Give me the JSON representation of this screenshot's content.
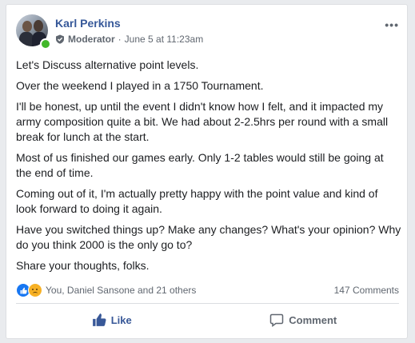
{
  "post": {
    "author": "Karl Perkins",
    "role": "Moderator",
    "separator": "·",
    "date": "June 5 at 11:23am",
    "more": "•••",
    "paragraphs": [
      "Let's Discuss alternative point levels.",
      "Over the weekend I played in a 1750 Tournament.",
      "I'll be honest, up until the event I didn't know how I felt, and it impacted my army composition quite a bit. We had about 2-2.5hrs per round with a small break for lunch at the start.",
      "Most of us finished our games early. Only 1-2 tables would still be going at the end of time.",
      "Coming out of it, I'm actually pretty happy with the point value and kind of look forward to doing it again.",
      "Have you switched things up? Make any changes? What's your opinion? Why do you think 2000 is the only go to?",
      "Share your thoughts, folks."
    ]
  },
  "reactions": {
    "icons": [
      "like-reaction-icon",
      "sad-reaction-icon"
    ],
    "summary": "You, Daniel Sansone and 21 others",
    "comments": "147 Comments"
  },
  "actions": {
    "like_label": "Like",
    "comment_label": "Comment"
  },
  "colors": {
    "link": "#365899",
    "online": "#42b72a",
    "like_blue": "#385898"
  }
}
